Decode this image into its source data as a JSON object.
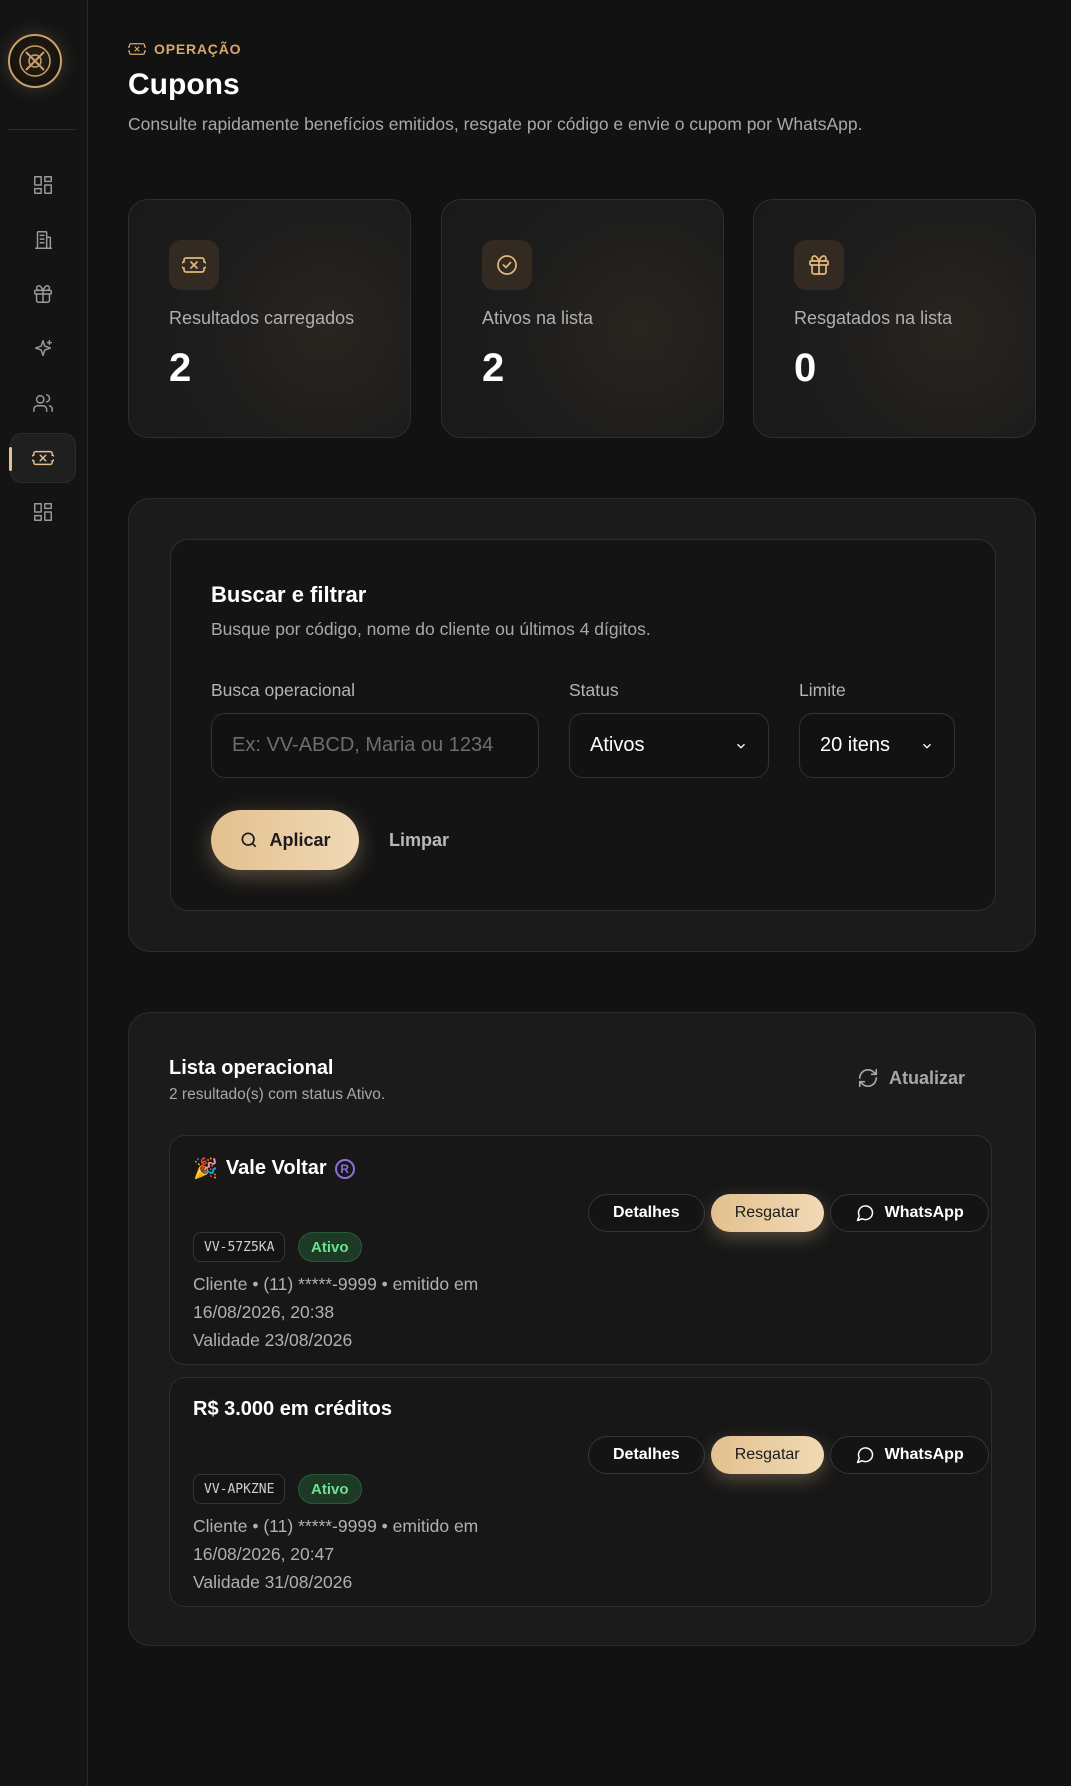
{
  "header": {
    "eyebrow": "OPERAÇÃO",
    "title": "Cupons",
    "subtitle": "Consulte rapidamente benefícios emitidos, resgate por código e envie o cupom por WhatsApp."
  },
  "sidebar": {
    "items": [
      {
        "icon": "dashboard-icon",
        "active": false
      },
      {
        "icon": "building-icon",
        "active": false
      },
      {
        "icon": "gift-icon",
        "active": false
      },
      {
        "icon": "sparkles-icon",
        "active": false
      },
      {
        "icon": "users-icon",
        "active": false
      },
      {
        "icon": "ticket-icon",
        "active": true
      },
      {
        "icon": "dashboard-icon",
        "active": false
      }
    ]
  },
  "stats": [
    {
      "icon": "ticket-icon",
      "label": "Resultados carregados",
      "value": "2"
    },
    {
      "icon": "check-circle-icon",
      "label": "Ativos na lista",
      "value": "2"
    },
    {
      "icon": "gift-icon",
      "label": "Resgatados na lista",
      "value": "0"
    }
  ],
  "filter": {
    "title": "Buscar e filtrar",
    "subtitle": "Busque por código, nome do cliente ou últimos 4 dígitos.",
    "search_label": "Busca operacional",
    "search_placeholder": "Ex: VV-ABCD, Maria ou 1234",
    "status_label": "Status",
    "status_value": "Ativos",
    "limit_label": "Limite",
    "limit_value": "20 itens",
    "apply_label": "Aplicar",
    "clear_label": "Limpar"
  },
  "list": {
    "title": "Lista operacional",
    "subtitle": "2 resultado(s) com status Ativo.",
    "refresh_label": "Atualizar",
    "actions": {
      "details": "Detalhes",
      "redeem": "Resgatar",
      "whatsapp": "WhatsApp"
    },
    "coupons": [
      {
        "emoji": "🎉",
        "name": "Vale Voltar",
        "reg": "R",
        "code": "VV-57Z5KA",
        "status": "Ativo",
        "info_line1": "Cliente • (11) *****-9999 • emitido em",
        "info_line2": "16/08/2026, 20:38",
        "validity": "Validade 23/08/2026"
      },
      {
        "emoji": "",
        "name": "R$ 3.000 em créditos",
        "code": "VV-APKZNE",
        "status": "Ativo",
        "info_line1": "Cliente • (11) *****-9999 • emitido em",
        "info_line2": "16/08/2026, 20:47",
        "validity": "Validade 31/08/2026"
      }
    ]
  },
  "colors": {
    "accent": "#e3c08e",
    "background": "#121212",
    "status_active": "#6fe08e"
  }
}
